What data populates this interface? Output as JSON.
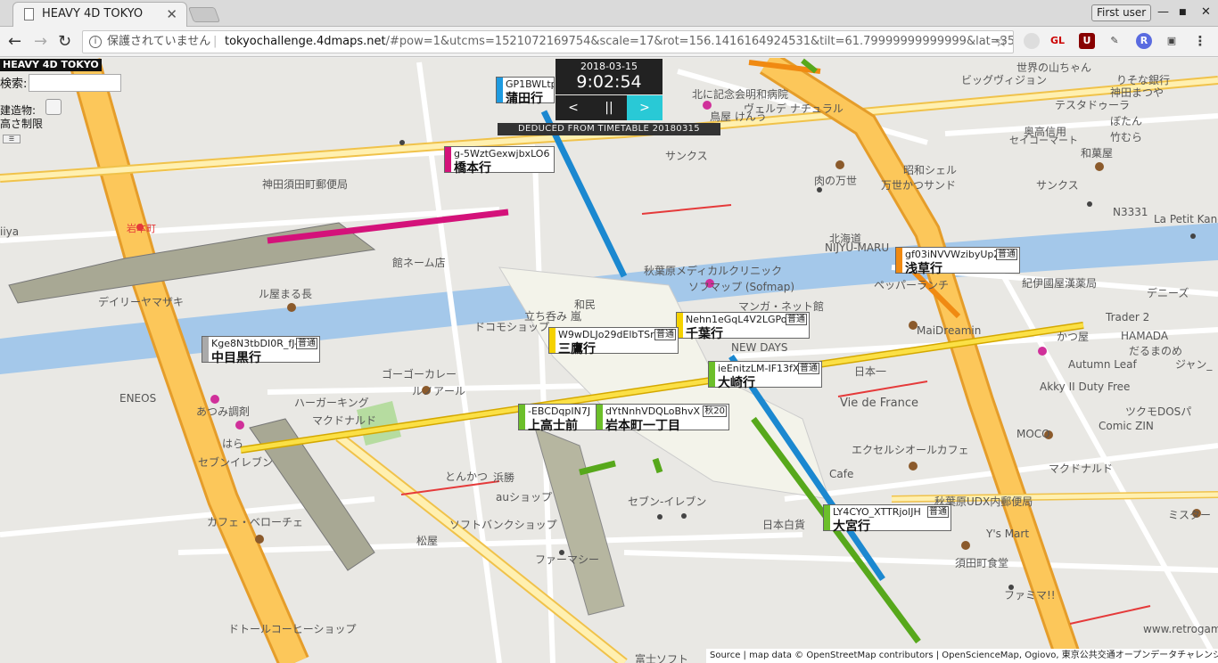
{
  "browser": {
    "tab_title": "HEAVY 4D TOKYO",
    "tab_close": "✕",
    "user_button": "First user",
    "win_min": "—",
    "win_max": "■",
    "win_close": "✕",
    "security_text": "保護されていません",
    "url_host": "tokyochallenge.4dmaps.net",
    "url_rest": "/#pow=1&utcms=1521072169754&scale=17&rot=156.1416164924531&tilt=61.79999999999999&lat=35....",
    "star": "☆",
    "ext_gl": "GL",
    "ext_ub": "U",
    "ext_r": "R"
  },
  "app": {
    "title": "HEAVY 4D TOKYO",
    "search_label": "検索:",
    "search_placeholder": "",
    "building_label": "建造物:",
    "height_label": "高さ制限",
    "menu_icon": "☰"
  },
  "clock": {
    "date": "2018-03-15",
    "time": "9:02:54",
    "prev": "<",
    "pause": "||",
    "next": ">",
    "deduced": "DEDUCED FROM TIMETABLE 20180315"
  },
  "trains": [
    {
      "id": "GP1BWLtplIKyG",
      "dest": "蒲田行",
      "color": "#1e9be0",
      "type": ""
    },
    {
      "id": "g-5WztGexwjbxLO6",
      "dest": "橋本行",
      "color": "#d4127a",
      "type": ""
    },
    {
      "id": "gf03iNVVWzibyUpZ",
      "dest": "浅草行",
      "color": "#f08a12",
      "type": "普通"
    },
    {
      "id": "Kge8N3tbDI0R_fJ-",
      "dest": "中目黒行",
      "color": "#aaaaaa",
      "type": "普通"
    },
    {
      "id": "Nehn1eGqL4V2LGPo",
      "dest": "千葉行",
      "color": "#f5d200",
      "type": "普通"
    },
    {
      "id": "W9wDLJo29dElbTSr",
      "dest": "三鷹行",
      "color": "#f5d200",
      "type": "普通"
    },
    {
      "id": "ieEnitzLM-IF13fX",
      "dest": "大崎行",
      "color": "#6cbf2a",
      "type": "普通"
    },
    {
      "id": "-EBCDqpIN7J",
      "dest": "上高士前",
      "color": "#6cbf2a",
      "type": ""
    },
    {
      "id": "dYtNnhVDQLoBhvX",
      "dest": "岩本町一丁目",
      "color": "#6cbf2a",
      "type": "秋20"
    },
    {
      "id": "LY4CYO_XTTRjolJH",
      "dest": "大宮行",
      "color": "#6cbf2a",
      "type": "普通"
    }
  ],
  "map_labels": [
    "世界の山ちゃん",
    "ビッグヴィジョン",
    "りそな銀行",
    "神田まつや",
    "テスタドゥーラ",
    "ぼたん",
    "竹むら",
    "奥高信用",
    "セイコーマート",
    "和菓屋",
    "鳥屋 けんう",
    "ヴェルデ ナチュラル",
    "ヴェルデ",
    "北に記念会明和病院",
    "サンクス",
    "昭和シェル",
    "肉の万世",
    "万世かつサンド",
    "サンクス",
    "N3331",
    "La Petit Kang",
    "神田須田町郵便局",
    "岩本町",
    "iiya",
    "館ネーム店",
    "北海道",
    "NIJYU-MARU",
    "ペッパーランチ",
    "紀伊國屋漢薬局",
    "デニーズ",
    "Trader 2",
    "秋葉原メディカルクリニック",
    "ソフマップ (Sofmap)",
    "デイリーヤマザキ",
    "ル屋まる長",
    "立ち呑み 嵐",
    "和民",
    "ドコモショップ",
    "マンガ・ネット館",
    "MaiDreamin",
    "かつ屋",
    "HAMADA",
    "だるまのめ",
    "Autumn Leaf",
    "ジャン_",
    "NEW DAYS",
    "日本一",
    "ゴーゴーカレー",
    "ルノアール",
    "ENEOS",
    "あつみ調剤",
    "ハーガーキング",
    "マクドナルド",
    "Vie de France",
    "Akky II Duty Free",
    "ツクモDOSパ",
    "Comic ZIN",
    "MOCO",
    "エクセルシオールカフェ",
    "マクドナルド",
    "はら",
    "セブンイレブン",
    "とんかつ",
    "浜勝",
    "auショップ",
    "セブン-イレブン",
    "Cafe",
    "秋葉原UDX内郵便局",
    "ミスター",
    "カフェ・ベローチェ",
    "ソフトバンクショップ",
    "松屋",
    "ファーマシー",
    "日本白貨",
    "Y's Mart",
    "須田町食堂",
    "ファミマ!!",
    "ドトールコーヒーショップ",
    "富士ソフト",
    "www.retrogam"
  ],
  "attribution": "Source | map data © OpenStreetMap contributors | OpenScienceMap, Ogiovo, 東京公共交通オープンデータチャレンジ"
}
